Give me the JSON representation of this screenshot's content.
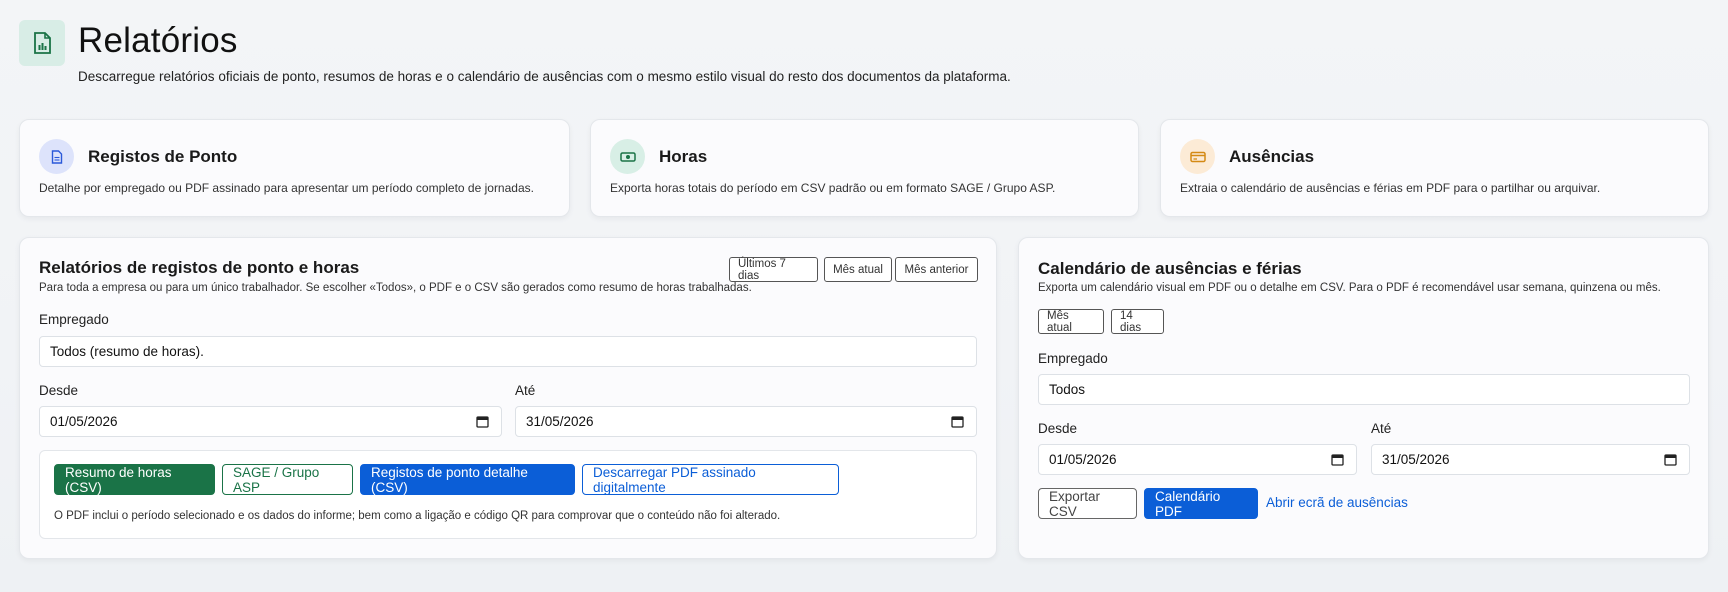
{
  "header": {
    "icon": "report-icon",
    "title": "Relatórios",
    "subtitle": "Descarregue relatórios oficiais de ponto, resumos de horas e o calendário de ausências com o mesmo estilo visual do resto dos documentos da plataforma."
  },
  "summary_cards": [
    {
      "icon": "document-icon",
      "title": "Registos de Ponto",
      "description": "Detalhe por empregado ou PDF assinado para apresentar um período completo de jornadas."
    },
    {
      "icon": "cash-icon",
      "title": "Horas",
      "description": "Exporta horas totais do período em CSV padrão ou em formato SAGE / Grupo ASP."
    },
    {
      "icon": "card-icon",
      "title": "Ausências",
      "description": "Extraia o calendário de ausências e férias em PDF para o partilhar ou arquivar."
    }
  ],
  "time_report": {
    "title": "Relatórios de registos de ponto e horas",
    "description": "Para toda a empresa ou para um único trabalhador. Se escolher «Todos», o PDF e o CSV são gerados como resumo de horas trabalhadas.",
    "quick_ranges": [
      "Últimos 7 dias",
      "Mês atual",
      "Mês anterior"
    ],
    "employee_label": "Empregado",
    "employee_value": "Todos (resumo de horas).",
    "from_label": "Desde",
    "from_value": "01/05/2026",
    "to_label": "Até",
    "to_value": "31/05/2026",
    "buttons": {
      "summary_csv": "Resumo de horas (CSV)",
      "sage": "SAGE / Grupo ASP",
      "detail_csv": "Registos de ponto detalhe (CSV)",
      "signed_pdf": "Descarregar PDF assinado digitalmente"
    },
    "note": "O PDF inclui o período selecionado e os dados do informe; bem como a ligação e código QR para comprovar que o conteúdo não foi alterado."
  },
  "absence_calendar": {
    "title": "Calendário de ausências e férias",
    "description": "Exporta um calendário visual em PDF ou o detalhe em CSV. Para o PDF é recomendável usar semana, quinzena ou mês.",
    "quick_ranges": [
      "Mês atual",
      "14 dias"
    ],
    "employee_label": "Empregado",
    "employee_value": "Todos",
    "from_label": "Desde",
    "from_value": "01/05/2026",
    "to_label": "Até",
    "to_value": "31/05/2026",
    "export_csv": "Exportar CSV",
    "calendar_pdf": "Calendário PDF",
    "open_absences": "Abrir ecrã de ausências"
  },
  "colors": {
    "green": "#1a7347",
    "blue": "#0b5ed7",
    "header_icon_bg": "#d8ede6",
    "doc_icon_bg": "#dde3fb",
    "cash_icon_bg": "#d8efe6",
    "card_icon_bg": "#fcebd6"
  }
}
